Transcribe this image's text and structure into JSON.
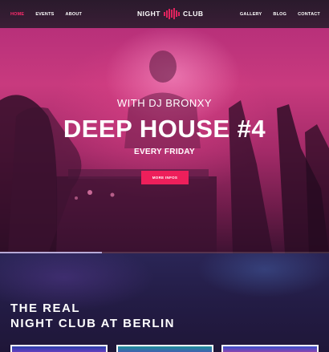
{
  "header": {
    "nav_left": [
      {
        "label": "HOME",
        "active": true
      },
      {
        "label": "EVENTS",
        "active": false
      },
      {
        "label": "ABOUT",
        "active": false
      }
    ],
    "logo": {
      "left": "NIGHT",
      "right": "CLUB",
      "icon": "equalizer-bars-icon"
    },
    "nav_right": [
      {
        "label": "GALLERY"
      },
      {
        "label": "BLOG"
      },
      {
        "label": "CONTACT"
      }
    ]
  },
  "hero": {
    "subtitle": "WITH DJ BRONXY",
    "title": "DEEP HOUSE #4",
    "schedule": "EVERY FRIDAY",
    "button_label": "MORE INFOS",
    "slider_progress_percent": 31
  },
  "about": {
    "title_line1": "THE REAL",
    "title_line2": "NIGHT CLUB AT BERLIN"
  },
  "colors": {
    "accent": "#ee1f5b",
    "active_nav": "#ff2b6d"
  }
}
